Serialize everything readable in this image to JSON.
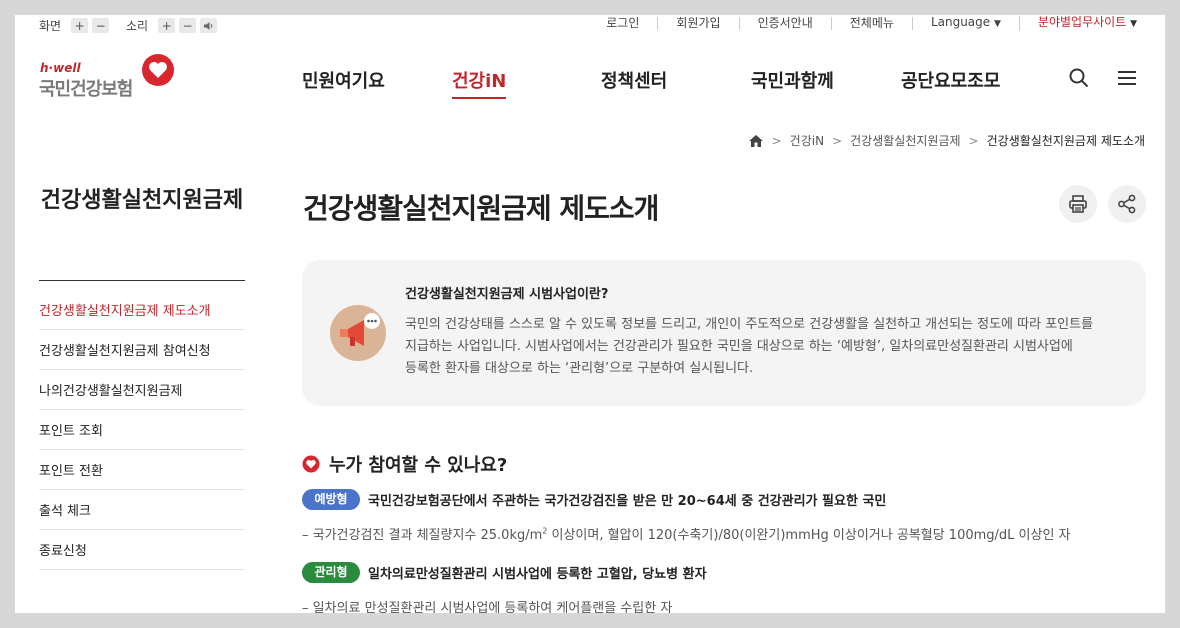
{
  "util": {
    "screen_label": "화면",
    "sound_label": "소리",
    "plus": "+",
    "minus": "−",
    "links": [
      "로그인",
      "회원가입",
      "인증서안내",
      "전체메뉴"
    ],
    "language": "Language",
    "sites": "분야별업무사이트",
    "caret": "▼"
  },
  "logo": {
    "en": "h·well",
    "ko": "국민건강보험"
  },
  "gnb": [
    "민원여기요",
    "건강iN",
    "정책센터",
    "국민과함께",
    "공단요모조모"
  ],
  "breadcrumb": {
    "items": [
      "건강iN",
      "건강생활실천지원금제"
    ],
    "current": "건강생활실천지원금제 제도소개",
    "sep": ">"
  },
  "sidebar": {
    "title": "건강생활실천지원금제",
    "items": [
      "건강생활실천지원금제 제도소개",
      "건강생활실천지원금제 참여신청",
      "나의건강생활실천지원금제",
      "포인트 조회",
      "포인트 전환",
      "출석 체크",
      "종료신청"
    ]
  },
  "page": {
    "title": "건강생활실천지원금제 제도소개"
  },
  "info": {
    "heading": "건강생활실천지원금제 시범사업이란?",
    "lines": [
      "국민의 건강상태를 스스로 알 수 있도록 정보를 드리고, 개인이 주도적으로 건강생활을 실천하고 개선되는 정도에 따라 포인트를",
      "지급하는 사업입니다. 시범사업에서는 건강관리가 필요한 국민을 대상으로 하는 ‘예방형’, 일차의료만성질환관리 시범사업에",
      "등록한 환자를 대상으로 하는 ‘관리형’으로 구분하여 실시됩니다."
    ]
  },
  "section": {
    "title": "누가 참여할 수 있나요?",
    "rows": [
      {
        "badge": "예방형",
        "badge_color": "#4a74c9",
        "text": "국민건강보험공단에서 주관하는 국가건강검진을 받은 만 20~64세 중 건강관리가 필요한 국민",
        "sub_pre": "– 국가건강검진 결과 체질량지수 25.0kg/m",
        "sub_sup": "2",
        "sub_post": " 이상이며, 혈압이 120(수축기)/80(이완기)mmHg 이상이거나 공복혈당 100mg/dL 이상인 자"
      },
      {
        "badge": "관리형",
        "badge_color": "#2a8a3e",
        "text": "일차의료만성질환관리 시범사업에 등록한 고혈압, 당뇨병 환자",
        "sub_pre": "– 일차의료 만성질환관리 시범사업에 등록하여 케어플랜을 수립한 자",
        "sub_sup": "",
        "sub_post": ""
      }
    ]
  },
  "colors": {
    "brand_red": "#c1272d",
    "info_bg": "#f4f4f4"
  }
}
